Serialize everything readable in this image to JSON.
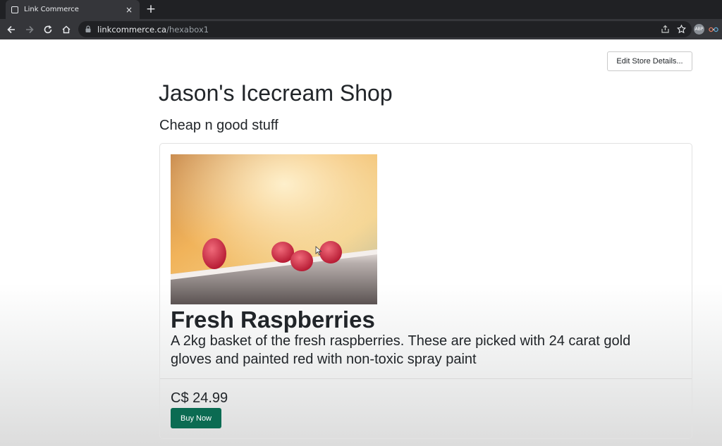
{
  "browser": {
    "tab_title": "Link Commerce",
    "tab_close": "×",
    "new_tab": "+",
    "url_host": "linkcommerce.ca",
    "url_path": "/hexabox1",
    "profile_initials": "ABP"
  },
  "page": {
    "edit_button_label": "Edit Store Details...",
    "store_title": "Jason's Icecream Shop",
    "store_subtitle": "Cheap n good stuff"
  },
  "product": {
    "name": "Fresh Raspberries",
    "description": "A 2kg basket of the fresh raspberries. These are picked with 24 carat gold gloves and painted red with non-toxic spray paint",
    "price": "C$ 24.99",
    "buy_label": "Buy Now"
  },
  "colors": {
    "chrome_dark": "#202124",
    "chrome_tab": "#35363a",
    "buy_button": "#0b6b52"
  }
}
